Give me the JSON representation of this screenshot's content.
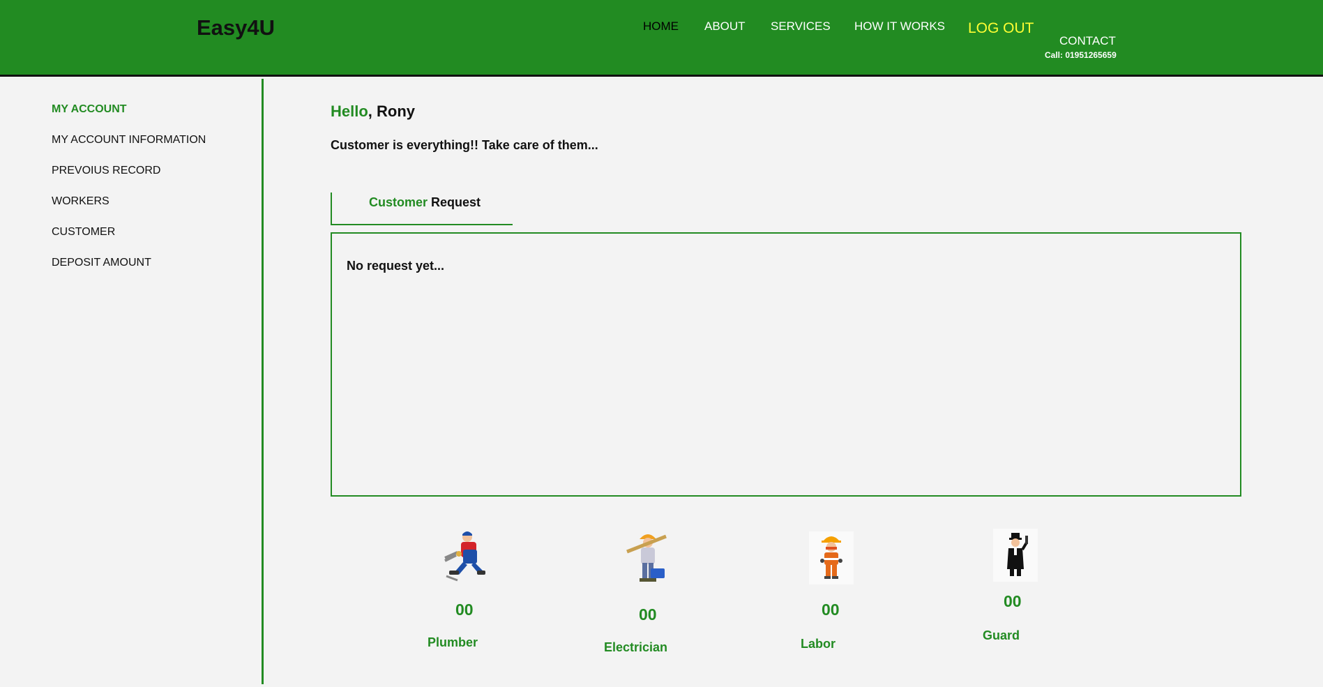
{
  "header": {
    "logo": "Easy4U",
    "nav": {
      "home": "HOME",
      "about": "ABOUT",
      "services": "SERVICES",
      "how_it_works": "HOW IT WORKS",
      "logout": "LOG OUT",
      "contact": "CONTACT",
      "call": "Call: 01951265659"
    }
  },
  "sidebar": {
    "items": [
      {
        "label": "MY ACCOUNT",
        "active": true
      },
      {
        "label": "MY ACCOUNT INFORMATION"
      },
      {
        "label": "PREVOIUS RECORD"
      },
      {
        "label": "WORKERS"
      },
      {
        "label": "CUSTOMER"
      },
      {
        "label": "DEPOSIT AMOUNT"
      }
    ]
  },
  "main": {
    "greeting_word": "Hello",
    "greeting_sep": ",",
    "user_name": "Rony",
    "tagline": "Customer is everything!! Take care of them...",
    "tab": {
      "highlight": "Customer",
      "rest": "Request"
    },
    "empty_message": "No request yet..."
  },
  "workers": [
    {
      "label": "Plumber",
      "count": "00",
      "icon": "plumber-icon"
    },
    {
      "label": "Electrician",
      "count": "00",
      "icon": "electrician-icon"
    },
    {
      "label": "Labor",
      "count": "00",
      "icon": "labor-icon"
    },
    {
      "label": "Guard",
      "count": "00",
      "icon": "guard-icon"
    }
  ],
  "colors": {
    "brand_green": "#228b22",
    "logout_yellow": "#ffff33",
    "background": "#f3f3f3"
  }
}
